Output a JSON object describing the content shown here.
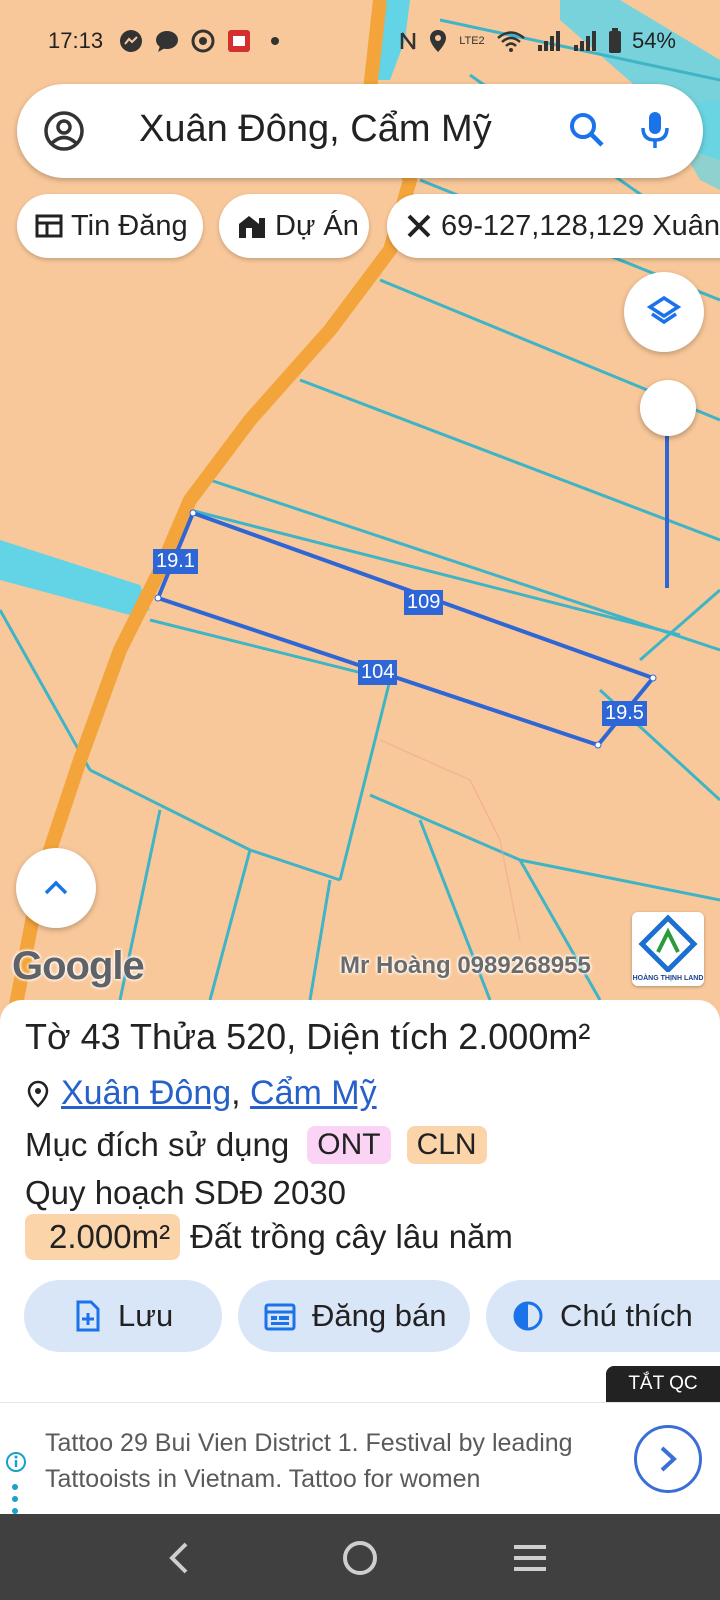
{
  "status_bar": {
    "time": "17:13",
    "battery": "54%",
    "network_label": "LTE2",
    "left_icons": [
      "messenger-icon",
      "chat-icon",
      "chrome-icon",
      "pdf-icon",
      "dot-icon"
    ],
    "right_icons": [
      "nfc-icon",
      "location-icon",
      "volte-icon",
      "wifi-icon",
      "signal-icon",
      "signal-icon",
      "battery-icon"
    ]
  },
  "search": {
    "query": "Xuân Đông, Cẩm Mỹ"
  },
  "chips": [
    {
      "label": "Tin Đăng",
      "icon": "listing-icon"
    },
    {
      "label": "Dự Án",
      "icon": "building-icon"
    },
    {
      "label": "69-127,128,129 Xuân",
      "icon": "ruler-cross-icon"
    }
  ],
  "map": {
    "parcel_labels": {
      "top": "109",
      "bottom": "104",
      "left": "19.1",
      "right": "19.5"
    },
    "google": "Google",
    "watermark": "Mr Hoàng 0989268955",
    "brand_text": "HOÀNG THỊNH LAND",
    "colors": {
      "land": "#f9c89a",
      "boundary": "#3fb4c6",
      "road": "#f3a43a",
      "parcel": "#2f66d6",
      "water": "#62d4e6"
    }
  },
  "info": {
    "title": "Tờ 43 Thửa 520, Diện tích 2.000m²",
    "location_parts": [
      "Xuân Đông",
      "Cẩm Mỹ"
    ],
    "separator": ",",
    "usage_label": "Mục đích sử dụng",
    "usage_tags": [
      "ONT",
      "CLN"
    ],
    "plan_label": "Quy hoạch SDĐ 2030",
    "area_value": "2.000m²",
    "area_desc": "Đất trồng cây lâu năm"
  },
  "actions": [
    {
      "label": "Lưu",
      "icon": "save-file-icon"
    },
    {
      "label": "Đăng bán",
      "icon": "calendar-icon"
    },
    {
      "label": "Chú thích",
      "icon": "half-circle-icon"
    }
  ],
  "ad": {
    "close_label": "TẮT QC",
    "text": "Tattoo 29 Bui Vien District 1. Festival by leading Tattooists in Vietnam. Tattoo for women"
  }
}
